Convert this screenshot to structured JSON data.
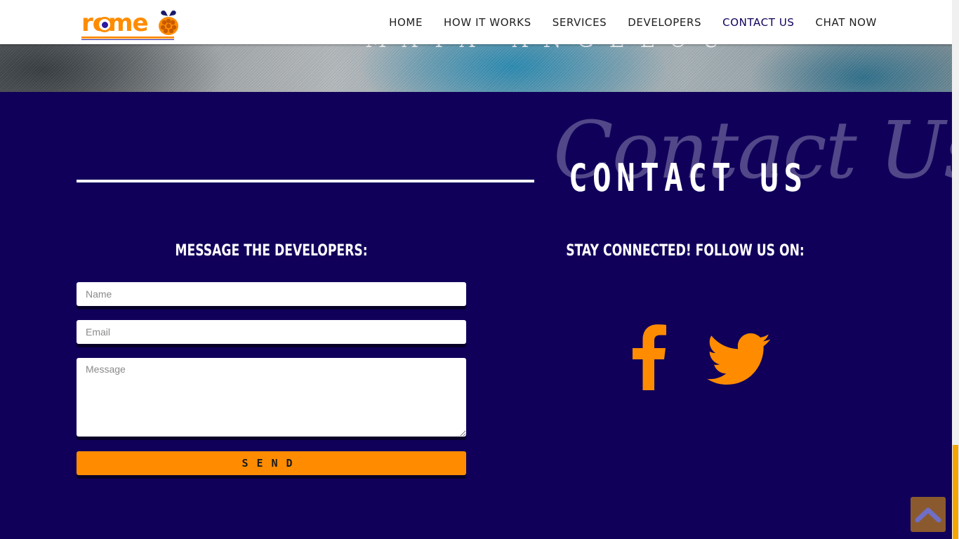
{
  "hero": {
    "quote_text": "MAYA ANGELOU"
  },
  "brand": {
    "logo_text": "rome",
    "accent": "#ff8c00",
    "navy": "#10005a"
  },
  "nav": {
    "items": [
      {
        "label": "HOME"
      },
      {
        "label": "HOW IT WORKS"
      },
      {
        "label": "SERVICES"
      },
      {
        "label": "DEVELOPERS"
      },
      {
        "label": "CONTACT US"
      },
      {
        "label": "CHAT NOW"
      }
    ],
    "active": "CONTACT US"
  },
  "contact": {
    "script_title": "Contact Us",
    "title": "CONTACT US",
    "form_heading": "MESSAGE THE DEVELOPERS:",
    "social_heading": "STAY CONNECTED! FOLLOW US ON:",
    "form": {
      "name_placeholder": "Name",
      "email_placeholder": "Email",
      "message_placeholder": "Message",
      "send_label": "SEND"
    },
    "social": [
      {
        "icon": "facebook-icon"
      },
      {
        "icon": "twitter-icon"
      }
    ]
  },
  "back_to_top": {
    "icon": "chevron-up-icon"
  }
}
